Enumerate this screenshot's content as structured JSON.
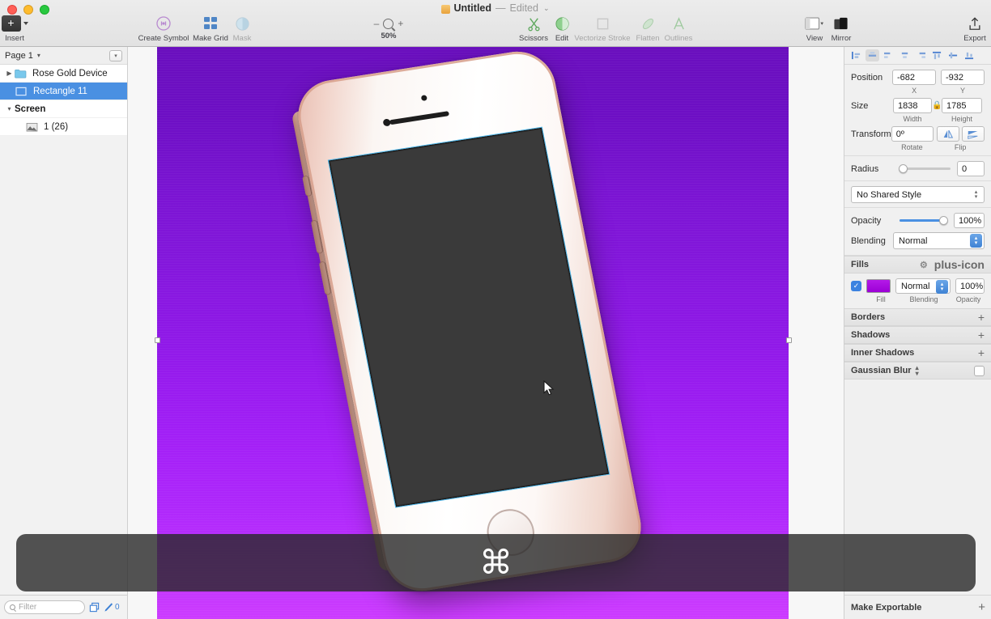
{
  "window": {
    "doc_title": "Untitled",
    "doc_separator": "—",
    "doc_state": "Edited",
    "doc_chevron": "⌄"
  },
  "toolbar": {
    "items": [
      {
        "label": "Insert",
        "icon": "plus-square-icon",
        "dim": false
      },
      {
        "label": "Create Symbol",
        "icon": "create-symbol-icon",
        "dim": false
      },
      {
        "label": "Make Grid",
        "icon": "make-grid-icon",
        "dim": false
      },
      {
        "label": "Mask",
        "icon": "mask-icon",
        "dim": true
      },
      {
        "label": "Scissors",
        "icon": "scissors-icon",
        "dim": false
      },
      {
        "label": "Edit",
        "icon": "edit-icon",
        "dim": false
      },
      {
        "label": "Vectorize Stroke",
        "icon": "vectorize-stroke-icon",
        "dim": true
      },
      {
        "label": "Flatten",
        "icon": "flatten-icon",
        "dim": true
      },
      {
        "label": "Outlines",
        "icon": "outlines-icon",
        "dim": true
      },
      {
        "label": "View",
        "icon": "view-icon",
        "dim": false
      },
      {
        "label": "Mirror",
        "icon": "mirror-icon",
        "dim": false
      },
      {
        "label": "Export",
        "icon": "export-icon",
        "dim": false
      }
    ],
    "zoom": {
      "minus": "–",
      "plus": "+",
      "level": "50%"
    }
  },
  "layers": {
    "page_name": "Page 1",
    "page_chevron": "▾",
    "items": [
      {
        "name": "Rose Gold Device",
        "icon": "folder-icon",
        "disclosure": "▶",
        "indent": 0,
        "selected": false
      },
      {
        "name": "Rectangle 11",
        "icon": "rectangle-icon",
        "disclosure": "",
        "indent": 1,
        "selected": true
      },
      {
        "name": "Screen",
        "icon": "artboard-icon",
        "disclosure": "▾",
        "indent": 0,
        "selected": false
      },
      {
        "name": "1 (26)",
        "icon": "image-icon",
        "disclosure": "",
        "indent": 2,
        "selected": false
      }
    ]
  },
  "inspector": {
    "align_icons": [
      "align-left-icon",
      "align-center-horizontal-icon",
      "distribute-left-icon",
      "distribute-center-icon",
      "distribute-right-icon",
      "align-top-icon",
      "align-middle-icon",
      "align-bottom-icon"
    ],
    "position": {
      "label": "Position",
      "x_value": "-682",
      "y_value": "-932",
      "x_sub": "X",
      "y_sub": "Y"
    },
    "size": {
      "label": "Size",
      "width_value": "1838",
      "height_value": "1785",
      "width_sub": "Width",
      "height_sub": "Height",
      "lock_icon": "lock-icon"
    },
    "transform": {
      "label": "Transform",
      "rotate_value": "0º",
      "rotate_sub": "Rotate",
      "flip_sub": "Flip",
      "flip_horizontal_icon": "flip-horizontal-icon",
      "flip_vertical_icon": "flip-vertical-icon"
    },
    "radius": {
      "label": "Radius",
      "value": "0"
    },
    "shared_style": "No Shared Style",
    "opacity": {
      "label": "Opacity",
      "value": "100%"
    },
    "blending": {
      "label": "Blending",
      "value": "Normal"
    },
    "fills": {
      "title": "Fills",
      "gear_icon": "gear-icon",
      "add_icon": "plus-icon",
      "checkbox": "✓",
      "color": "#b41ae8",
      "blending_value": "Normal",
      "opacity_value": "100%",
      "sub_fill": "Fill",
      "sub_blending": "Blending",
      "sub_opacity": "Opacity"
    },
    "sections": [
      {
        "title": "Borders",
        "add": "+"
      },
      {
        "title": "Shadows",
        "add": "+"
      },
      {
        "title": "Inner Shadows",
        "add": "+"
      }
    ],
    "gaussian_blur": {
      "title": "Gaussian Blur",
      "chevron": "⌃⌄"
    },
    "make_exportable": {
      "title": "Make Exportable",
      "add": "+"
    }
  },
  "bottom_bar": {
    "filter_placeholder": "Filter",
    "search_icon": "search-icon",
    "duplicate_icon": "duplicate-icon",
    "pen_icon": "pen-icon",
    "count": "0"
  },
  "canvas": {
    "artboard_fill_top": "#6a0fbe",
    "artboard_fill_bottom": "#cc3bff",
    "device_label": "rose-gold-iphone",
    "key_overlay_glyph": "⌘"
  }
}
